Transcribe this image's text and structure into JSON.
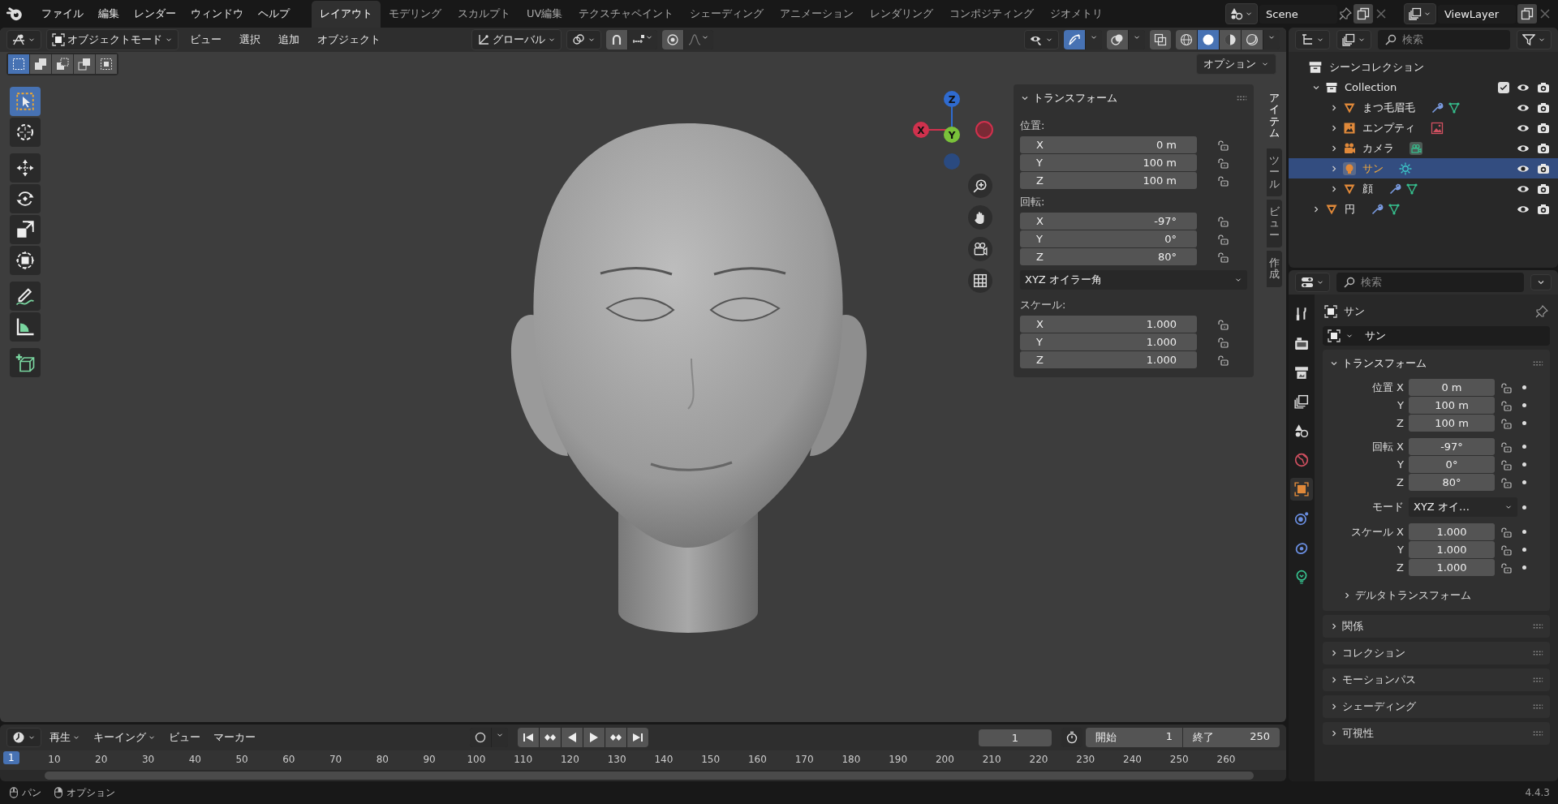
{
  "top_menu": [
    "ファイル",
    "編集",
    "レンダー",
    "ウィンドウ",
    "ヘルプ"
  ],
  "workspaces": [
    {
      "label": "レイアウト",
      "selected": true
    },
    {
      "label": "モデリング",
      "selected": false
    },
    {
      "label": "スカルプト",
      "selected": false
    },
    {
      "label": "UV編集",
      "selected": false
    },
    {
      "label": "テクスチャペイント",
      "selected": false
    },
    {
      "label": "シェーディング",
      "selected": false
    },
    {
      "label": "アニメーション",
      "selected": false
    },
    {
      "label": "レンダリング",
      "selected": false
    },
    {
      "label": "コンポジティング",
      "selected": false
    },
    {
      "label": "ジオメトリ",
      "selected": false
    }
  ],
  "scene": {
    "name": "Scene"
  },
  "view_layer": {
    "name": "ViewLayer"
  },
  "viewport": {
    "mode": "オブジェクトモード",
    "menus": [
      "ビュー",
      "選択",
      "追加",
      "オブジェクト"
    ],
    "orientation": "グローバル",
    "gizmos_on": true,
    "shading": [
      {
        "kind": "wireframe",
        "selected": false
      },
      {
        "kind": "solid",
        "selected": true
      },
      {
        "kind": "material",
        "selected": false
      },
      {
        "kind": "rendered",
        "selected": false
      }
    ],
    "select_modes": [
      {
        "kind": "new",
        "selected": true
      },
      {
        "kind": "extend",
        "selected": false
      },
      {
        "kind": "subtract",
        "selected": false
      },
      {
        "kind": "invert",
        "selected": false
      },
      {
        "kind": "intersect",
        "selected": false
      }
    ],
    "options": "オプション",
    "tool_groups": [
      [
        {
          "kind": "select",
          "selected": true
        },
        {
          "kind": "cursor",
          "selected": false
        }
      ],
      [
        {
          "kind": "move",
          "selected": false
        },
        {
          "kind": "rotate",
          "selected": false
        },
        {
          "kind": "scale",
          "selected": false
        },
        {
          "kind": "transform",
          "selected": false
        }
      ],
      [
        {
          "kind": "annotate",
          "selected": false
        },
        {
          "kind": "measure",
          "selected": false
        }
      ],
      [
        {
          "kind": "add_cube",
          "selected": false
        }
      ]
    ],
    "axis_labels": [
      "Z",
      "X",
      "Y"
    ],
    "sidebar": {
      "tabs": [
        {
          "label": "アイテム",
          "selected": true
        },
        {
          "label": "ツール",
          "selected": false
        },
        {
          "label": "ビュー",
          "selected": false
        },
        {
          "label": "作成",
          "selected": false
        }
      ],
      "title": "トランスフォーム",
      "location": {
        "label": "位置:",
        "rows": [
          {
            "axis": "X",
            "value": "0 m"
          },
          {
            "axis": "Y",
            "value": "100 m"
          },
          {
            "axis": "Z",
            "value": "100 m"
          }
        ]
      },
      "rotation": {
        "label": "回転:",
        "rows": [
          {
            "axis": "X",
            "value": "-97°"
          },
          {
            "axis": "Y",
            "value": "0°"
          },
          {
            "axis": "Z",
            "value": "80°"
          }
        ]
      },
      "rotation_mode": "XYZ オイラー角",
      "scale": {
        "label": "スケール:",
        "rows": [
          {
            "axis": "X",
            "value": "1.000"
          },
          {
            "axis": "Y",
            "value": "1.000"
          },
          {
            "axis": "Z",
            "value": "1.000"
          }
        ]
      }
    }
  },
  "outliner": {
    "search_placeholder": "検索",
    "root": "シーンコレクション",
    "tree": [
      {
        "name": "Collection",
        "kind": "collection",
        "expanded": true,
        "checked": true,
        "selected": false,
        "children": [
          {
            "name": "まつ毛眉毛",
            "kind": "mesh",
            "expanded": false,
            "selected": false,
            "extras": [
              {
                "kind": "modifier"
              },
              {
                "kind": "mesh_data"
              }
            ]
          },
          {
            "name": "エンプティ",
            "kind": "empty",
            "expanded": false,
            "selected": false,
            "extras": [
              {
                "kind": "image_data"
              }
            ]
          },
          {
            "name": "カメラ",
            "kind": "camera",
            "expanded": false,
            "selected": false,
            "extras": [
              {
                "kind": "camera_data"
              }
            ]
          },
          {
            "name": "サン",
            "kind": "light",
            "expanded": false,
            "selected": true,
            "extras": [
              {
                "kind": "sun_data"
              }
            ]
          },
          {
            "name": "顔",
            "kind": "mesh",
            "expanded": false,
            "selected": false,
            "extras": [
              {
                "kind": "modifier"
              },
              {
                "kind": "mesh_data"
              }
            ]
          }
        ]
      },
      {
        "name": "円",
        "kind": "mesh",
        "expanded": false,
        "selected": false,
        "extras": [
          {
            "kind": "modifier"
          },
          {
            "kind": "mesh_data"
          }
        ]
      }
    ]
  },
  "properties": {
    "search_placeholder": "検索",
    "tabs": [
      {
        "kind": "tool",
        "selected": false
      },
      {
        "kind": "render",
        "selected": false
      },
      {
        "kind": "output",
        "selected": false
      },
      {
        "kind": "view_layer",
        "selected": false
      },
      {
        "kind": "scene",
        "selected": false
      },
      {
        "kind": "world",
        "selected": false
      },
      {
        "kind": "object",
        "selected": true
      },
      {
        "kind": "physics",
        "selected": false
      },
      {
        "kind": "constraints",
        "selected": false
      },
      {
        "kind": "light_data",
        "selected": false
      }
    ],
    "object_name": "サン",
    "name_field": "サン",
    "transform": {
      "title": "トランスフォーム",
      "groups": [
        {
          "rows": [
            {
              "kind": "field",
              "label": "位置 X",
              "value": "0 m"
            },
            {
              "kind": "field",
              "label": "Y",
              "value": "100 m"
            },
            {
              "kind": "field",
              "label": "Z",
              "value": "100 m"
            }
          ]
        },
        {
          "rows": [
            {
              "kind": "field",
              "label": "回転 X",
              "value": "-97°"
            },
            {
              "kind": "field",
              "label": "Y",
              "value": "0°"
            },
            {
              "kind": "field",
              "label": "Z",
              "value": "80°"
            }
          ]
        },
        {
          "rows": [
            {
              "kind": "dropdown",
              "label": "モード",
              "value": "XYZ オイ…"
            }
          ]
        },
        {
          "rows": [
            {
              "kind": "field",
              "label": "スケール X",
              "value": "1.000"
            },
            {
              "kind": "field",
              "label": "Y",
              "value": "1.000"
            },
            {
              "kind": "field",
              "label": "Z",
              "value": "1.000"
            }
          ]
        }
      ],
      "subpanel": "デルタトランスフォーム"
    },
    "panels": [
      "関係",
      "コレクション",
      "モーションパス",
      "シェーディング",
      "可視性"
    ]
  },
  "timeline": {
    "menus": [
      {
        "label": "再生",
        "dropdown": true
      },
      {
        "label": "キーイング",
        "dropdown": true
      },
      {
        "label": "ビュー",
        "dropdown": false
      },
      {
        "label": "マーカー",
        "dropdown": false
      }
    ],
    "current_frame": "1",
    "start_label": "開始",
    "start": "1",
    "end_label": "終了",
    "end": "250",
    "playhead": "1",
    "ruler": [
      "10",
      "20",
      "30",
      "40",
      "50",
      "60",
      "70",
      "80",
      "90",
      "100",
      "110",
      "120",
      "130",
      "140",
      "150",
      "160",
      "170",
      "180",
      "190",
      "200",
      "210",
      "220",
      "230",
      "240",
      "250",
      "260"
    ]
  },
  "status_bar": {
    "hints": [
      {
        "kind": "pan",
        "label": "パン"
      },
      {
        "kind": "options",
        "label": "オプション"
      }
    ],
    "version": "4.4.3"
  }
}
